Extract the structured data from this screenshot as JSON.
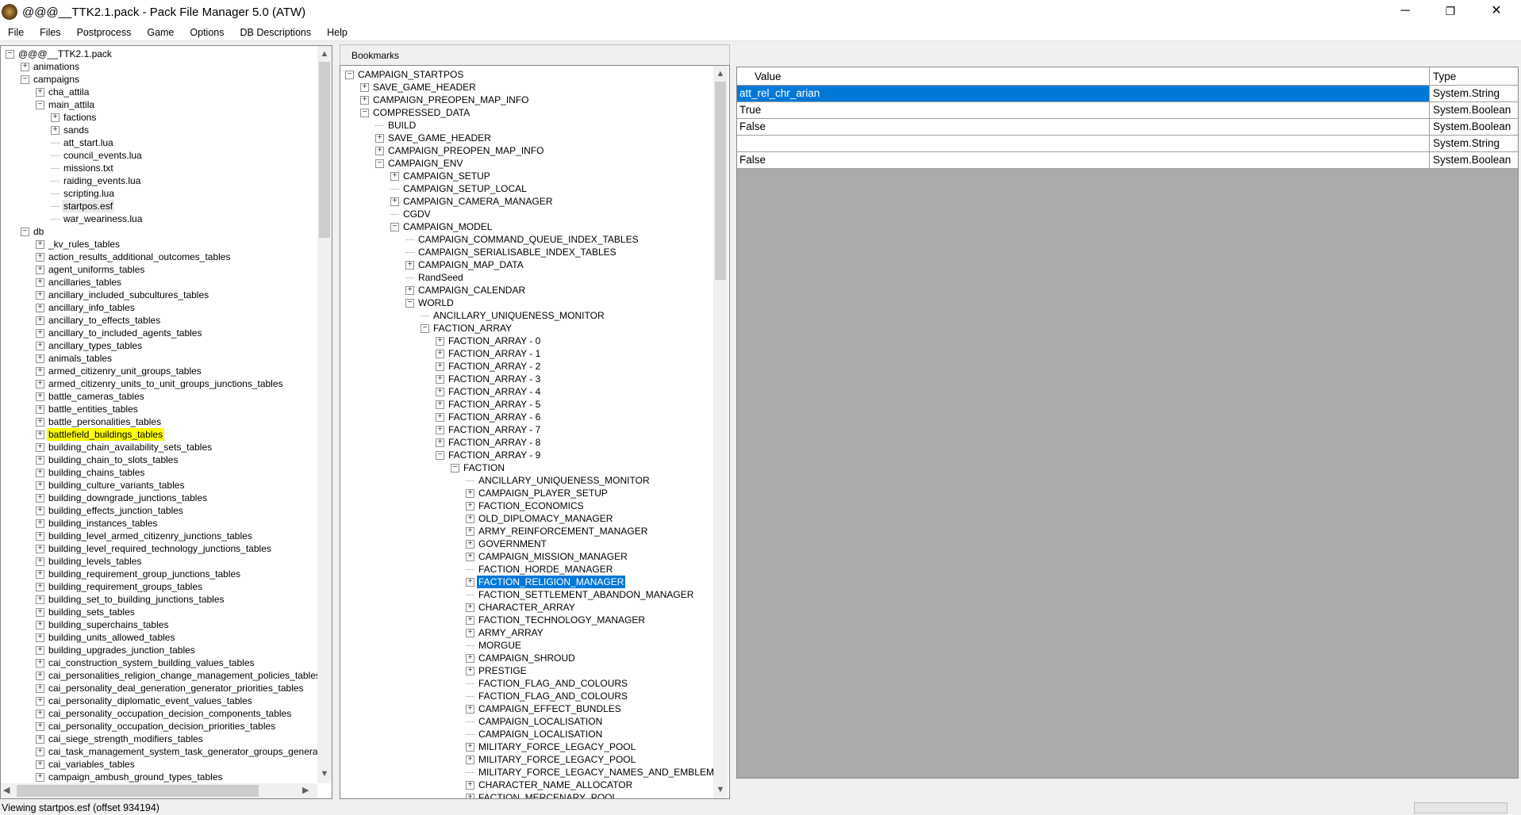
{
  "window": {
    "title": "@@@__TTK2.1.pack - Pack File Manager 5.0 (ATW)",
    "minimize": "─",
    "maximize": "❐",
    "close": "✕"
  },
  "menu": [
    "File",
    "Files",
    "Postprocess",
    "Game",
    "Options",
    "DB Descriptions",
    "Help"
  ],
  "pack_tree": [
    [
      0,
      "minus",
      "@@@__TTK2.1.pack"
    ],
    [
      1,
      "plus",
      "animations"
    ],
    [
      1,
      "minus",
      "campaigns"
    ],
    [
      2,
      "plus",
      "cha_attila"
    ],
    [
      2,
      "minus",
      "main_attila"
    ],
    [
      3,
      "plus",
      "factions"
    ],
    [
      3,
      "plus",
      "sands"
    ],
    [
      3,
      "leaf",
      "att_start.lua"
    ],
    [
      3,
      "leaf",
      "council_events.lua"
    ],
    [
      3,
      "leaf",
      "missions.txt"
    ],
    [
      3,
      "leaf",
      "raiding_events.lua"
    ],
    [
      3,
      "leaf",
      "scripting.lua"
    ],
    [
      3,
      "leaf",
      "startpos.esf",
      "hover"
    ],
    [
      3,
      "leaf",
      "war_weariness.lua"
    ],
    [
      1,
      "minus",
      "db"
    ],
    [
      2,
      "plus",
      "_kv_rules_tables"
    ],
    [
      2,
      "plus",
      "action_results_additional_outcomes_tables"
    ],
    [
      2,
      "plus",
      "agent_uniforms_tables"
    ],
    [
      2,
      "plus",
      "ancillaries_tables"
    ],
    [
      2,
      "plus",
      "ancillary_included_subcultures_tables"
    ],
    [
      2,
      "plus",
      "ancillary_info_tables"
    ],
    [
      2,
      "plus",
      "ancillary_to_effects_tables"
    ],
    [
      2,
      "plus",
      "ancillary_to_included_agents_tables"
    ],
    [
      2,
      "plus",
      "ancillary_types_tables"
    ],
    [
      2,
      "plus",
      "animals_tables"
    ],
    [
      2,
      "plus",
      "armed_citizenry_unit_groups_tables"
    ],
    [
      2,
      "plus",
      "armed_citizenry_units_to_unit_groups_junctions_tables"
    ],
    [
      2,
      "plus",
      "battle_cameras_tables"
    ],
    [
      2,
      "plus",
      "battle_entities_tables"
    ],
    [
      2,
      "plus",
      "battle_personalities_tables"
    ],
    [
      2,
      "plus",
      "battlefield_buildings_tables",
      "yellow"
    ],
    [
      2,
      "plus",
      "building_chain_availability_sets_tables"
    ],
    [
      2,
      "plus",
      "building_chain_to_slots_tables"
    ],
    [
      2,
      "plus",
      "building_chains_tables"
    ],
    [
      2,
      "plus",
      "building_culture_variants_tables"
    ],
    [
      2,
      "plus",
      "building_downgrade_junctions_tables"
    ],
    [
      2,
      "plus",
      "building_effects_junction_tables"
    ],
    [
      2,
      "plus",
      "building_instances_tables"
    ],
    [
      2,
      "plus",
      "building_level_armed_citizenry_junctions_tables"
    ],
    [
      2,
      "plus",
      "building_level_required_technology_junctions_tables"
    ],
    [
      2,
      "plus",
      "building_levels_tables"
    ],
    [
      2,
      "plus",
      "building_requirement_group_junctions_tables"
    ],
    [
      2,
      "plus",
      "building_requirement_groups_tables"
    ],
    [
      2,
      "plus",
      "building_set_to_building_junctions_tables"
    ],
    [
      2,
      "plus",
      "building_sets_tables"
    ],
    [
      2,
      "plus",
      "building_superchains_tables"
    ],
    [
      2,
      "plus",
      "building_units_allowed_tables"
    ],
    [
      2,
      "plus",
      "building_upgrades_junction_tables"
    ],
    [
      2,
      "plus",
      "cai_construction_system_building_values_tables"
    ],
    [
      2,
      "plus",
      "cai_personalities_religion_change_management_policies_tables"
    ],
    [
      2,
      "plus",
      "cai_personality_deal_generation_generator_priorities_tables"
    ],
    [
      2,
      "plus",
      "cai_personality_diplomatic_event_values_tables"
    ],
    [
      2,
      "plus",
      "cai_personality_occupation_decision_components_tables"
    ],
    [
      2,
      "plus",
      "cai_personality_occupation_decision_priorities_tables"
    ],
    [
      2,
      "plus",
      "cai_siege_strength_modifiers_tables"
    ],
    [
      2,
      "plus",
      "cai_task_management_system_task_generator_groups_generators_jun"
    ],
    [
      2,
      "plus",
      "cai_variables_tables"
    ],
    [
      2,
      "plus",
      "campaign_ambush_ground_types_tables"
    ]
  ],
  "bookmarks_label": "Bookmarks",
  "esf_tree": [
    [
      0,
      "minus",
      "CAMPAIGN_STARTPOS"
    ],
    [
      1,
      "plus",
      "SAVE_GAME_HEADER"
    ],
    [
      1,
      "plus",
      "CAMPAIGN_PREOPEN_MAP_INFO"
    ],
    [
      1,
      "minus",
      "COMPRESSED_DATA"
    ],
    [
      2,
      "leaf",
      "BUILD"
    ],
    [
      2,
      "plus",
      "SAVE_GAME_HEADER"
    ],
    [
      2,
      "plus",
      "CAMPAIGN_PREOPEN_MAP_INFO"
    ],
    [
      2,
      "minus",
      "CAMPAIGN_ENV"
    ],
    [
      3,
      "plus",
      "CAMPAIGN_SETUP"
    ],
    [
      3,
      "leaf",
      "CAMPAIGN_SETUP_LOCAL"
    ],
    [
      3,
      "plus",
      "CAMPAIGN_CAMERA_MANAGER"
    ],
    [
      3,
      "leaf",
      "CGDV"
    ],
    [
      3,
      "minus",
      "CAMPAIGN_MODEL"
    ],
    [
      4,
      "leaf",
      "CAMPAIGN_COMMAND_QUEUE_INDEX_TABLES"
    ],
    [
      4,
      "leaf",
      "CAMPAIGN_SERIALISABLE_INDEX_TABLES"
    ],
    [
      4,
      "plus",
      "CAMPAIGN_MAP_DATA"
    ],
    [
      4,
      "leaf",
      "RandSeed"
    ],
    [
      4,
      "plus",
      "CAMPAIGN_CALENDAR"
    ],
    [
      4,
      "minus",
      "WORLD"
    ],
    [
      5,
      "leaf",
      "ANCILLARY_UNIQUENESS_MONITOR"
    ],
    [
      5,
      "minus",
      "FACTION_ARRAY"
    ],
    [
      6,
      "plus",
      "FACTION_ARRAY - 0"
    ],
    [
      6,
      "plus",
      "FACTION_ARRAY - 1"
    ],
    [
      6,
      "plus",
      "FACTION_ARRAY - 2"
    ],
    [
      6,
      "plus",
      "FACTION_ARRAY - 3"
    ],
    [
      6,
      "plus",
      "FACTION_ARRAY - 4"
    ],
    [
      6,
      "plus",
      "FACTION_ARRAY - 5"
    ],
    [
      6,
      "plus",
      "FACTION_ARRAY - 6"
    ],
    [
      6,
      "plus",
      "FACTION_ARRAY - 7"
    ],
    [
      6,
      "plus",
      "FACTION_ARRAY - 8"
    ],
    [
      6,
      "minus",
      "FACTION_ARRAY - 9"
    ],
    [
      7,
      "minus",
      "FACTION"
    ],
    [
      8,
      "leaf",
      "ANCILLARY_UNIQUENESS_MONITOR"
    ],
    [
      8,
      "plus",
      "CAMPAIGN_PLAYER_SETUP"
    ],
    [
      8,
      "plus",
      "FACTION_ECONOMICS"
    ],
    [
      8,
      "plus",
      "OLD_DIPLOMACY_MANAGER"
    ],
    [
      8,
      "plus",
      "ARMY_REINFORCEMENT_MANAGER"
    ],
    [
      8,
      "plus",
      "GOVERNMENT"
    ],
    [
      8,
      "plus",
      "CAMPAIGN_MISSION_MANAGER"
    ],
    [
      8,
      "leaf",
      "FACTION_HORDE_MANAGER"
    ],
    [
      8,
      "plus",
      "FACTION_RELIGION_MANAGER",
      "sel"
    ],
    [
      8,
      "leaf",
      "FACTION_SETTLEMENT_ABANDON_MANAGER"
    ],
    [
      8,
      "plus",
      "CHARACTER_ARRAY"
    ],
    [
      8,
      "plus",
      "FACTION_TECHNOLOGY_MANAGER"
    ],
    [
      8,
      "plus",
      "ARMY_ARRAY"
    ],
    [
      8,
      "leaf",
      "MORGUE"
    ],
    [
      8,
      "plus",
      "CAMPAIGN_SHROUD"
    ],
    [
      8,
      "plus",
      "PRESTIGE"
    ],
    [
      8,
      "leaf",
      "FACTION_FLAG_AND_COLOURS"
    ],
    [
      8,
      "leaf",
      "FACTION_FLAG_AND_COLOURS"
    ],
    [
      8,
      "plus",
      "CAMPAIGN_EFFECT_BUNDLES"
    ],
    [
      8,
      "leaf",
      "CAMPAIGN_LOCALISATION"
    ],
    [
      8,
      "leaf",
      "CAMPAIGN_LOCALISATION"
    ],
    [
      8,
      "plus",
      "MILITARY_FORCE_LEGACY_POOL"
    ],
    [
      8,
      "plus",
      "MILITARY_FORCE_LEGACY_POOL"
    ],
    [
      8,
      "leaf",
      "MILITARY_FORCE_LEGACY_NAMES_AND_EMBLEMS"
    ],
    [
      8,
      "plus",
      "CHARACTER_NAME_ALLOCATOR"
    ],
    [
      8,
      "plus",
      "FACTION_MERCENARY_POOL"
    ]
  ],
  "grid": {
    "headers": {
      "value": "Value",
      "type": "Type"
    },
    "rows": [
      {
        "value": "att_rel_chr_arian",
        "type": "System.String",
        "selected": true
      },
      {
        "value": "True",
        "type": "System.Boolean"
      },
      {
        "value": "False",
        "type": "System.Boolean"
      },
      {
        "value": "",
        "type": "System.String"
      },
      {
        "value": "False",
        "type": "System.Boolean"
      }
    ]
  },
  "status": "Viewing startpos.esf (offset 934194)",
  "colors": {
    "selection": "#0078d7",
    "search_highlight": "#ffff00",
    "grid_background": "#ababab"
  }
}
